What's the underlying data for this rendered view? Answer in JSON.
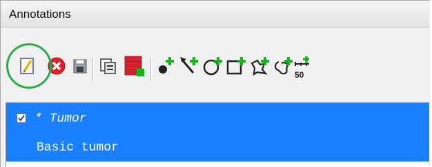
{
  "panel": {
    "title": "Annotations"
  },
  "toolbar": {
    "items": [
      {
        "icon": "edit-note-icon"
      },
      {
        "icon": "delete-icon"
      },
      {
        "icon": "save-icon"
      },
      {
        "icon": "copy-icon"
      },
      {
        "icon": "layers-add-icon"
      },
      {
        "icon": "add-point-icon"
      },
      {
        "icon": "add-line-icon"
      },
      {
        "icon": "add-ellipse-icon"
      },
      {
        "icon": "add-rectangle-icon"
      },
      {
        "icon": "add-polygon-icon"
      },
      {
        "icon": "add-freehand-icon"
      },
      {
        "icon": "add-ruler-icon",
        "label": "50"
      }
    ]
  },
  "annotation": {
    "checked": true,
    "marker": "*",
    "name": "Tumor",
    "description": "Basic tumor"
  },
  "colors": {
    "selection": "#1a80ff",
    "highlight": "#2aaa48",
    "add_badge": "#13b21e",
    "delete": "#e0202a"
  }
}
